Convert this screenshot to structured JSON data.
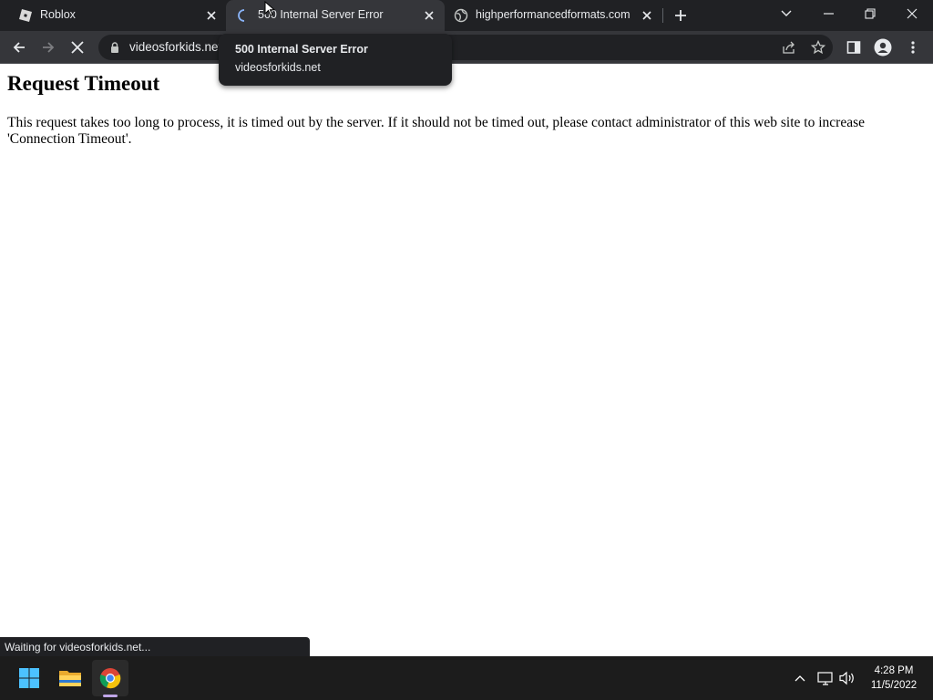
{
  "browser": {
    "tabs": [
      {
        "title": "Roblox",
        "favicon": "roblox-icon",
        "active": false
      },
      {
        "title": "500 Internal Server Error",
        "favicon": "loading-spinner-icon",
        "active": true
      },
      {
        "title": "highperformancedformats.com",
        "favicon": "globe-icon",
        "active": false
      }
    ],
    "url": "videosforkids.net",
    "hover_card": {
      "title": "500 Internal Server Error",
      "domain": "videosforkids.net"
    },
    "status_text": "Waiting for videosforkids.net..."
  },
  "page": {
    "heading": "Request Timeout",
    "body": "This request takes too long to process, it is timed out by the server. If it should not be timed out, please contact administrator of this web site to increase 'Connection Timeout'."
  },
  "taskbar": {
    "apps": [
      "windows-start-icon",
      "file-explorer-icon",
      "chrome-icon"
    ],
    "time": "4:28 PM",
    "date": "11/5/2022"
  },
  "colors": {
    "tabstrip_bg": "#202124",
    "toolbar_bg": "#35363a",
    "taskbar_bg": "#1c1c1c",
    "text_light": "#e8eaed"
  }
}
